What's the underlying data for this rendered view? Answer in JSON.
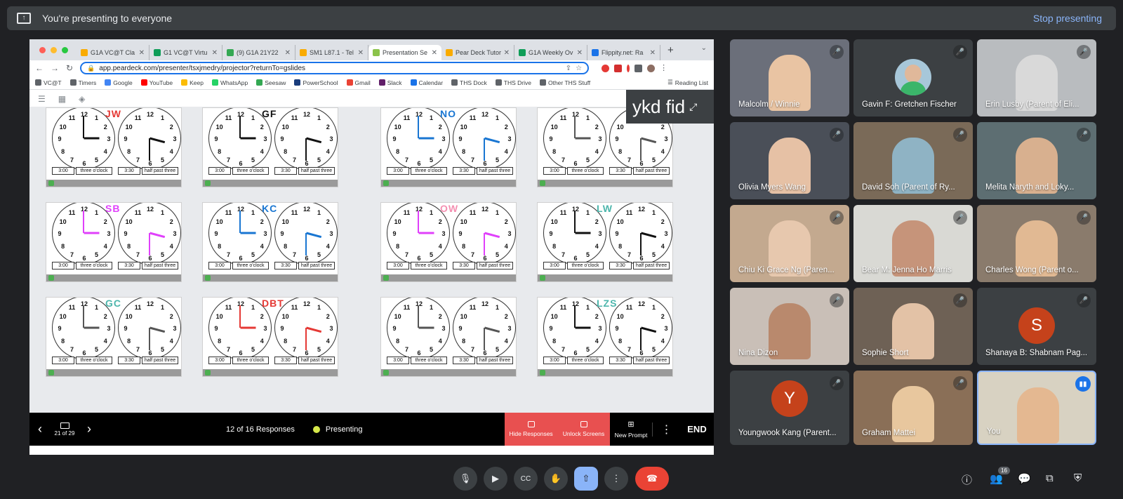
{
  "banner": {
    "text": "You're presenting to everyone",
    "stop": "Stop presenting",
    "icon": "present-icon"
  },
  "browser": {
    "tabs": [
      {
        "label": "G1A VC@T Cla",
        "color": "#f9ab00"
      },
      {
        "label": "G1 VC@T Virtu",
        "color": "#0f9d58"
      },
      {
        "label": "(9) G1A 21Y22",
        "color": "#34a853"
      },
      {
        "label": "SM1 L87.1 - Tel",
        "color": "#f9ab00"
      },
      {
        "label": "Presentation Se",
        "color": "#8bc34a"
      },
      {
        "label": "Pear Deck Tutor",
        "color": "#f9ab00"
      },
      {
        "label": "G1A Weekly Ov",
        "color": "#0f9d58"
      },
      {
        "label": "Flippity.net: Ra",
        "color": "#1a73e8"
      }
    ],
    "url": "app.peardeck.com/presenter/tsxjmedry/projector?returnTo=gslides",
    "bookmarks": [
      {
        "label": "VC@T",
        "color": "#5f6368"
      },
      {
        "label": "Timers",
        "color": "#5f6368"
      },
      {
        "label": "Google",
        "color": "#4285f4"
      },
      {
        "label": "YouTube",
        "color": "#ff0000"
      },
      {
        "label": "Keep",
        "color": "#fbbc04"
      },
      {
        "label": "WhatsApp",
        "color": "#25d366"
      },
      {
        "label": "Seesaw",
        "color": "#34a853"
      },
      {
        "label": "PowerSchool",
        "color": "#1a3d7c"
      },
      {
        "label": "Gmail",
        "color": "#ea4335"
      },
      {
        "label": "Slack",
        "color": "#611f69"
      },
      {
        "label": "Calendar",
        "color": "#1a73e8"
      },
      {
        "label": "THS Dock",
        "color": "#5f6368"
      },
      {
        "label": "THS Drive",
        "color": "#5f6368"
      },
      {
        "label": "Other THS Stuff",
        "color": "#5f6368"
      }
    ],
    "reading_list": "Reading List"
  },
  "overlay_text": "ykd fid",
  "clock_labels": {
    "t1": "3:00",
    "w1": "three o'clock",
    "t2": "3:30",
    "w2": "half past three"
  },
  "responses": [
    {
      "initials": "JW",
      "color": "#e53935",
      "ink": "#111111"
    },
    {
      "initials": "GF",
      "color": "#111111",
      "ink": "#111111"
    },
    {
      "initials": "NO",
      "color": "#1976d2",
      "ink": "#1976d2"
    },
    {
      "initials": "",
      "color": "#111111",
      "ink": "#555555"
    },
    {
      "initials": "SB",
      "color": "#e040fb",
      "ink": "#e040fb"
    },
    {
      "initials": "KC",
      "color": "#1976d2",
      "ink": "#1976d2"
    },
    {
      "initials": "OW",
      "color": "#f48fb1",
      "ink": "#e040fb"
    },
    {
      "initials": "LW",
      "color": "#4db6ac",
      "ink": "#111111"
    },
    {
      "initials": "GC",
      "color": "#4db6ac",
      "ink": "#555555"
    },
    {
      "initials": "DBT",
      "color": "#e53935",
      "ink": "#e53935"
    },
    {
      "initials": "",
      "color": "#111111",
      "ink": "#555555"
    },
    {
      "initials": "LZS",
      "color": "#4db6ac",
      "ink": "#111111"
    }
  ],
  "peardeck": {
    "slide_position": "21 of 29",
    "responses": "12 of 16 Responses",
    "status": "Presenting",
    "hide": "Hide Responses",
    "unlock": "Unlock Screens",
    "new_prompt": "New Prompt",
    "end": "END"
  },
  "participants": [
    {
      "name": "Malcolm / Winnie",
      "kind": "video",
      "bg": "#6b6f7a",
      "skin": "#e9c4a3"
    },
    {
      "name": "Gavin F: Gretchen Fischer",
      "kind": "photo",
      "bg": "#3c4043"
    },
    {
      "name": "Erin Lusby (Parent of Eli...",
      "kind": "video",
      "bg": "#b9bcbf",
      "skin": "#d9d9d9"
    },
    {
      "name": "Olivia Myers Wang",
      "kind": "video",
      "bg": "#4a4f58",
      "skin": "#e6c1a5"
    },
    {
      "name": "David Soh (Parent of Ry...",
      "kind": "video",
      "bg": "#7a6a58",
      "skin": "#8fb3c4"
    },
    {
      "name": "Melita Naryth and Loky...",
      "kind": "video",
      "bg": "#5d6e72",
      "skin": "#d8b08f"
    },
    {
      "name": "Chiu Ki Grace Ng (Paren...",
      "kind": "video",
      "bg": "#c3a98f",
      "skin": "#e7c8ae"
    },
    {
      "name": "Bear M: Jenna Ho Marris",
      "kind": "video",
      "bg": "#d9d9d4",
      "skin": "#c6947a"
    },
    {
      "name": "Charles Wong (Parent o...",
      "kind": "video",
      "bg": "#8a7b6c",
      "skin": "#e1b993"
    },
    {
      "name": "Nina Dizon",
      "kind": "video",
      "bg": "#c9bfb7",
      "skin": "#b9896d"
    },
    {
      "name": "Sophie Short",
      "kind": "video",
      "bg": "#6e6155",
      "skin": "#e3c2a6"
    },
    {
      "name": "Shanaya B: Shabnam Pag...",
      "kind": "avatar",
      "letter": "S",
      "avatar_color": "#c5421b"
    },
    {
      "name": "Youngwook Kang (Parent...",
      "kind": "avatar",
      "letter": "Y",
      "avatar_color": "#c5421b"
    },
    {
      "name": "Graham Mattei",
      "kind": "video",
      "bg": "#8a6f57",
      "skin": "#e8c79e"
    },
    {
      "name": "You",
      "kind": "video",
      "bg": "#d8d2c2",
      "skin": "#e4b891"
    }
  ],
  "participant_count": "16",
  "colors": {
    "accent": "#8ab4f8",
    "hangup": "#ea4335",
    "pd_red": "#e85050",
    "present_btn": "#8ab4f8"
  }
}
